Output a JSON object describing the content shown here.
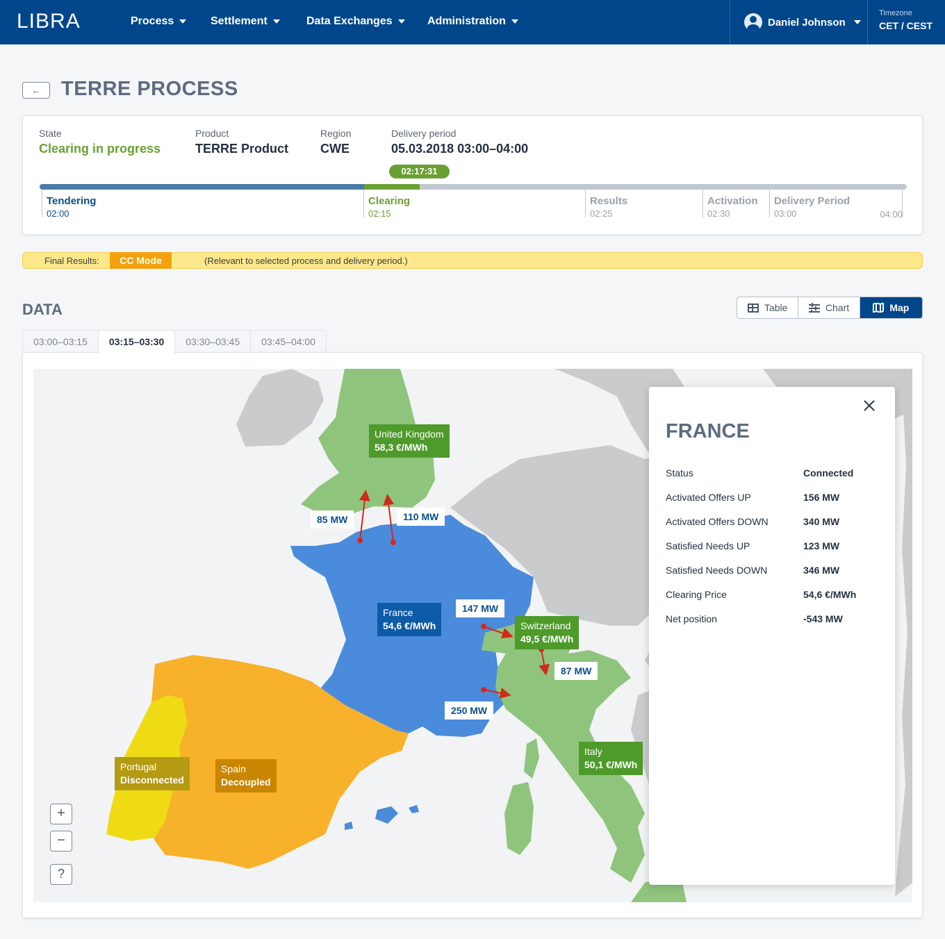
{
  "app": {
    "logo": "LIBRA",
    "nav": [
      "Process",
      "Settlement",
      "Data Exchanges",
      "Administration"
    ],
    "user": "Daniel Johnson",
    "timezone_label": "Timezone",
    "timezone_value": "CET / CEST"
  },
  "header": {
    "back_icon": "←",
    "title": "TERRE PROCESS"
  },
  "process": {
    "state_label": "State",
    "state_value": "Clearing in progress",
    "product_label": "Product",
    "product_value": "TERRE Product",
    "region_label": "Region",
    "region_value": "CWE",
    "delivery_label": "Delivery period",
    "delivery_value": "05.03.2018 03:00–04:00",
    "timer": "02:17:31",
    "progress": {
      "completed_through": "02:15",
      "current_time": "02:17:31"
    },
    "phases": [
      {
        "name": "Tendering",
        "time": "02:00"
      },
      {
        "name": "Clearing",
        "time": "02:15"
      },
      {
        "name": "Results",
        "time": "02:25"
      },
      {
        "name": "Activation",
        "time": "02:30"
      },
      {
        "name": "Delivery Period",
        "time": "03:00"
      }
    ],
    "end_time": "04:00"
  },
  "banner": {
    "label": "Final Results:",
    "mode": "CC Mode",
    "note": "(Relevant to selected process and delivery period.)"
  },
  "data": {
    "title": "DATA",
    "views": [
      "Table",
      "Chart",
      "Map"
    ],
    "active_view": "Map",
    "tabs": [
      "03:00–03:15",
      "03:15–03:30",
      "03:30–03:45",
      "03:45–04:00"
    ],
    "active_tab": "03:15–03:30"
  },
  "map": {
    "countries": {
      "uk": {
        "name": "United Kingdom",
        "price": "58,3 €/MWh"
      },
      "france": {
        "name": "France",
        "price": "54,6 €/MWh"
      },
      "switzerland": {
        "name": "Switzerland",
        "price": "49,5 €/MWh"
      },
      "italy": {
        "name": "Italy",
        "price": "50,1 €/MWh"
      },
      "portugal": {
        "name": "Portugal",
        "status": "Disconnected"
      },
      "spain": {
        "name": "Spain",
        "status": "Decoupled"
      }
    },
    "flows": [
      "85 MW",
      "110 MW",
      "147 MW",
      "87 MW",
      "250 MW"
    ],
    "controls": {
      "zoom_in": "+",
      "zoom_out": "−",
      "help": "?"
    },
    "colors": {
      "connected": "#8fc47d",
      "selected": "#4a8bdc",
      "decoupled": "#f7b12b",
      "disconnected": "#eedb14",
      "other": "#c9cbcd",
      "arrow": "#d12a1c"
    }
  },
  "panel": {
    "title": "FRANCE",
    "rows": [
      {
        "key": "Status",
        "value": "Connected"
      },
      {
        "key": "Activated Offers UP",
        "value": "156 MW"
      },
      {
        "key": "Activated Offers DOWN",
        "value": "340 MW"
      },
      {
        "key": "Satisfied Needs UP",
        "value": "123 MW"
      },
      {
        "key": "Satisfied Needs DOWN",
        "value": "346 MW"
      },
      {
        "key": "Clearing Price",
        "value": "54,6 €/MWh"
      },
      {
        "key": "Net position",
        "value": "-543 MW"
      }
    ]
  }
}
